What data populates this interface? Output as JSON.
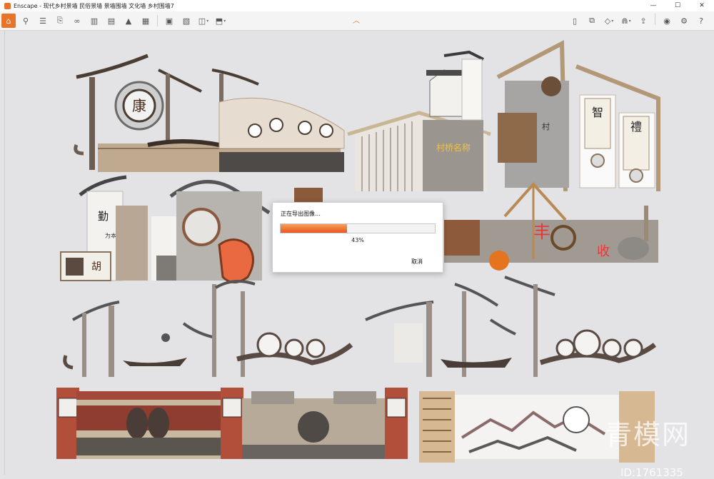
{
  "window": {
    "title": "Enscape - 现代乡村景墙 民俗景墙 景墙围墙 文化墙 乡村围墙7",
    "minimize": "—",
    "maximize": "☐",
    "close": "✕"
  },
  "toolbar": {
    "left_icons": [
      "home-icon",
      "location-icon",
      "bim-icon",
      "export-icon",
      "binoculars-icon",
      "building-icon",
      "buildings-icon",
      "image-icon",
      "clapper-icon",
      "screenshot-icon",
      "batch-render-icon",
      "panorama-icon",
      "exe-export-icon"
    ],
    "right_icons": [
      "map-icon",
      "assets-icon",
      "cube-icon",
      "material-icon",
      "upload-icon",
      "eye-icon",
      "settings-icon",
      "help-icon"
    ]
  },
  "dialog": {
    "title": "正在导出图像…",
    "progress": 43,
    "percent_text": "43%",
    "cancel_label": "取消"
  },
  "scene": {
    "sign_1": "康",
    "sign_2": "村桥名称",
    "sign_3": "智",
    "sign_4": "禮",
    "sign_5": "勤为本",
    "sign_6": "胡",
    "sign_7": "丰",
    "sign_8": "收"
  },
  "watermark": {
    "text": "青模网",
    "id": "ID:1761335"
  },
  "colors": {
    "accent": "#e8742a",
    "progress_start": "#f6a05a",
    "progress_end": "#e8561f"
  }
}
